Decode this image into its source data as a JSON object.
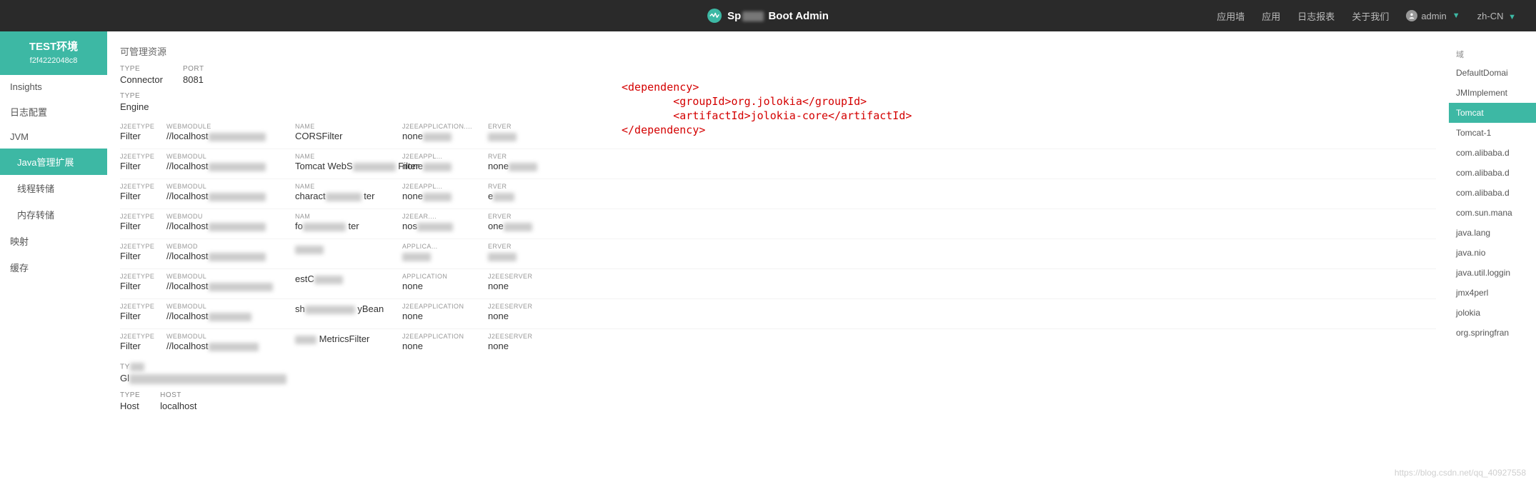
{
  "brand": {
    "prefix": "Sp",
    "suffix": "Boot Admin"
  },
  "topnav": {
    "apps_wall": "应用墙",
    "apps": "应用",
    "logs": "日志报表",
    "about": "关于我们",
    "user": "admin",
    "locale": "zh-CN"
  },
  "env": {
    "title": "TEST环境",
    "id": "f2f4222048c8"
  },
  "sidebar": {
    "items": [
      {
        "label": "Insights",
        "sub": false,
        "active": false
      },
      {
        "label": "日志配置",
        "sub": false,
        "active": false
      },
      {
        "label": "JVM",
        "sub": false,
        "active": false
      },
      {
        "label": "Java管理扩展",
        "sub": true,
        "active": true
      },
      {
        "label": "线程转储",
        "sub": true,
        "active": false
      },
      {
        "label": "内存转储",
        "sub": true,
        "active": false
      },
      {
        "label": "映射",
        "sub": false,
        "active": false
      },
      {
        "label": "缓存",
        "sub": false,
        "active": false
      }
    ]
  },
  "main": {
    "section_title": "可管理资源",
    "connector": {
      "type_label": "TYPE",
      "type_val": "Connector",
      "port_label": "PORT",
      "port_val": "8081"
    },
    "engine": {
      "type_label": "TYPE",
      "type_val": "Engine"
    },
    "headers": {
      "j2eetype": "J2EETYPE",
      "webmodule": "WEBMODULE",
      "name": "NAME",
      "j2eeapp": "J2EEAPPLICATION",
      "j2eeserver": "J2EESERVER",
      "j2eeappl": "J2EEAPPL",
      "j2eear": "J2EEAR",
      "erver": "ERVER",
      "rver": "RVER"
    },
    "rows": [
      {
        "j2eetype": "Filter",
        "webmodule": "//localhost",
        "name": "CORSFilter",
        "j2eeapp": "none",
        "j2eeserver": ""
      },
      {
        "j2eetype": "Filter",
        "webmodule": "//localhost",
        "name": "Tomcat WebS",
        "name_tail": "Filter",
        "j2eeapp": "none",
        "j2eeserver": "none"
      },
      {
        "j2eetype": "Filter",
        "webmodule": "//localhost",
        "name": "charact",
        "name_tail": "ter",
        "j2eeapp": "none",
        "j2eeserver": "e"
      },
      {
        "j2eetype": "Filter",
        "webmodule": "//localhost",
        "name": "fo",
        "name_tail": "ter",
        "j2eeapp": "nos",
        "j2eeserver": "one"
      },
      {
        "j2eetype": "Filter",
        "webmodule": "//localhost",
        "name": "",
        "j2eeapp": "",
        "j2eeserver": ""
      },
      {
        "j2eetype": "Filter",
        "webmodule": "//localhost",
        "name": "estC",
        "j2eeapp": "none",
        "j2eeserver": "none"
      },
      {
        "j2eetype": "Filter",
        "webmodule": "//localhost",
        "name": "sh",
        "name_tail": "yBean",
        "j2eeapp": "none",
        "j2eeserver": "none"
      },
      {
        "j2eetype": "Filter",
        "webmodule": "//localhost",
        "name": "",
        "name_tail": "MetricsFilter",
        "j2eeapp": "none",
        "j2eeserver": "none"
      }
    ],
    "glrow": {
      "type_label": "TY",
      "type_val": "Gl"
    },
    "hostrow": {
      "type_label": "TYPE",
      "type_val": "Host",
      "host_label": "HOST",
      "host_val": "localhost"
    }
  },
  "rightbar": {
    "header": "域",
    "items": [
      "DefaultDomai",
      "JMImplement",
      "Tomcat",
      "Tomcat-1",
      "com.alibaba.d",
      "com.alibaba.d",
      "com.alibaba.d",
      "com.sun.mana",
      "java.lang",
      "java.nio",
      "java.util.loggin",
      "jmx4perl",
      "jolokia",
      "org.springfran"
    ],
    "active_index": 2
  },
  "overlay": "<dependency>\n        <groupId>org.jolokia</groupId>\n        <artifactId>jolokia-core</artifactId>\n</dependency>",
  "watermark": "https://blog.csdn.net/qq_40927558"
}
